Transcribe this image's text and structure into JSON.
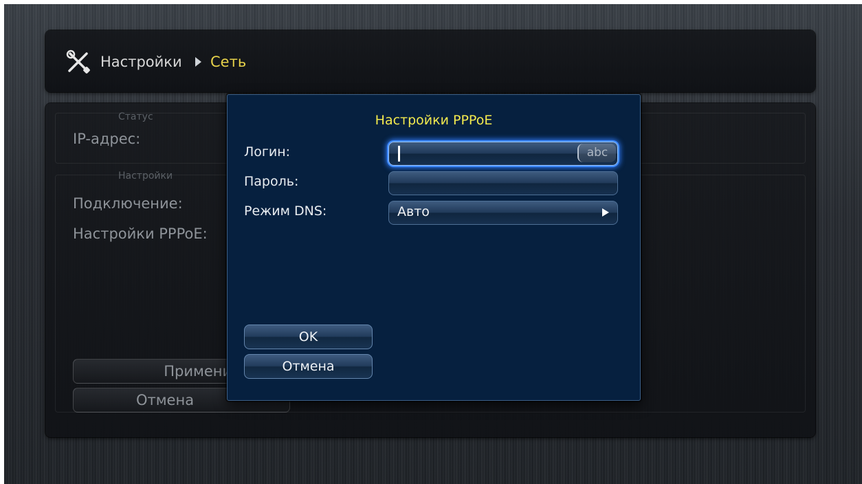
{
  "breadcrumb": {
    "root": "Настройки",
    "current": "Сеть"
  },
  "background_panel": {
    "status_group_title": "Статус",
    "ip_label": "IP-адрес:",
    "settings_group_title": "Настройки",
    "connection_label": "Подключение:",
    "pppoe_label": "Настройки PPPoE:",
    "apply_button": "Применить",
    "cancel_button": "Отмена"
  },
  "dialog": {
    "title": "Настройки PPPoE",
    "login_label": "Логин:",
    "login_value": "",
    "input_mode": "abc",
    "password_label": "Пароль:",
    "password_value": "",
    "dns_label": "Режим DNS:",
    "dns_value": "Авто",
    "ok_button": "OK",
    "cancel_button": "Отмена"
  },
  "colors": {
    "accent_yellow": "#e7d24a",
    "dialog_bg": "#06203f",
    "focus_glow": "#2f7cff"
  },
  "icons": [
    "wrench-screwdriver-icon",
    "breadcrumb-arrow-icon",
    "play-arrow-icon"
  ]
}
